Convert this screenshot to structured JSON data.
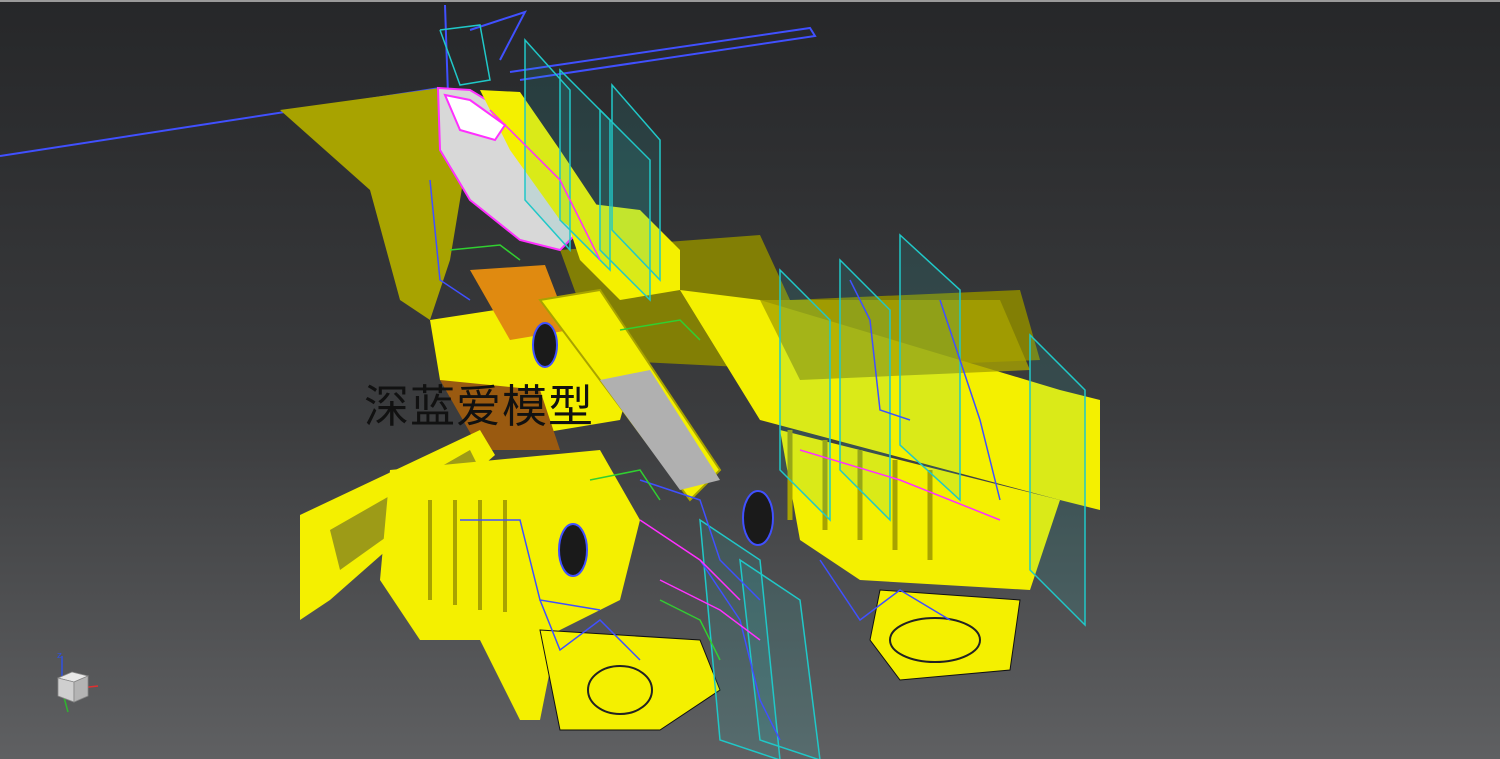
{
  "viewport": {
    "watermark_text": "深蓝爱模型"
  },
  "view_cube": {
    "x_color": "#e03030",
    "y_color": "#2fb52f",
    "z_color": "#3050e0"
  },
  "colors": {
    "bg_top": "#262729",
    "bg_bottom": "#5f6062",
    "body_yellow": "#f4f000",
    "dark_yellow": "#a8a300",
    "olive": "#8b8700",
    "orange": "#e08a10",
    "brown": "#9a5a10",
    "wire_blue": "#4050ff",
    "wire_cyan": "#20c8c8",
    "wire_magenta": "#ff30ff",
    "wire_green": "#30d030"
  }
}
